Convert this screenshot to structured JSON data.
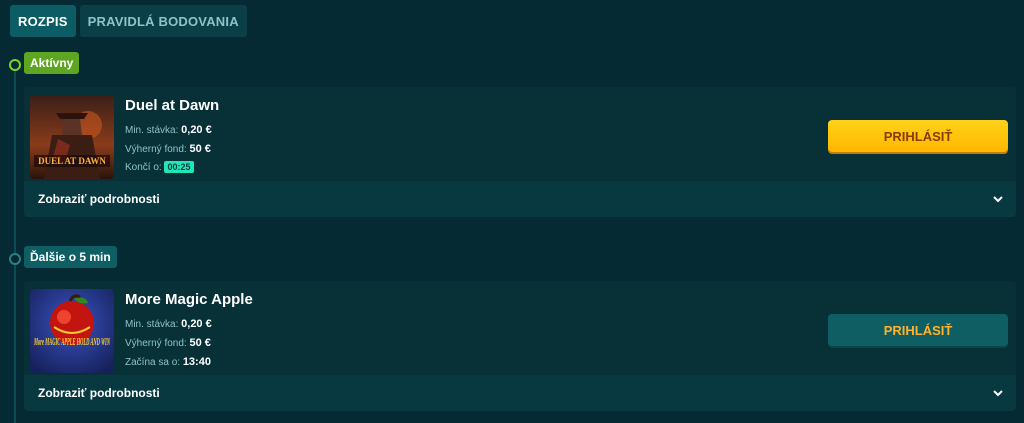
{
  "tabs": [
    {
      "label": "ROZPIS",
      "active": true
    },
    {
      "label": "PRAVIDLÁ BODOVANIA",
      "active": false
    }
  ],
  "stages": [
    {
      "label": "Aktívny",
      "color": "#5ea621",
      "game": {
        "title": "Duel at Dawn",
        "thumb_text": "DUEL AT DAWN",
        "min_bet_label": "Min. stávka:",
        "min_bet": "0,20 €",
        "prize_label": "Výherný fond:",
        "prize": "50 €",
        "time_label": "Končí o:",
        "time": "00:25",
        "button": "PRIHLÁSIŤ",
        "details": "Zobraziť podrobnosti"
      }
    },
    {
      "label": "Ďalšie o 5 min",
      "color": "#0e5e64",
      "game": {
        "title": "More Magic Apple",
        "thumb_text": "More MAGIC APPLE HOLD AND WIN",
        "min_bet_label": "Min. stávka:",
        "min_bet": "0,20 €",
        "prize_label": "Výherný fond:",
        "prize": "50 €",
        "time_label": "Začína sa o:",
        "time": "13:40",
        "button": "PRIHLÁSIŤ",
        "details": "Zobraziť podrobnosti"
      }
    }
  ]
}
